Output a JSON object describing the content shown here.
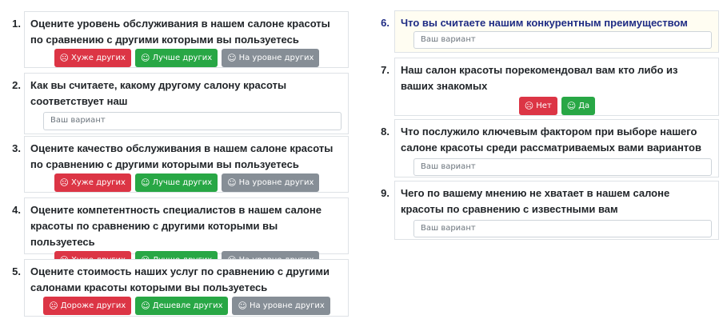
{
  "placeholder": "Ваш вариант",
  "icons": {
    "sad": "sad-face-icon",
    "smile": "smile-face-icon",
    "neutral": "neutral-face-icon"
  },
  "colors": {
    "danger": "#dc3545",
    "success": "#28a745",
    "secondary": "#868e96",
    "active_text": "#1f2c84"
  },
  "questions": {
    "q1": {
      "num": "1.",
      "text": "Оцените уровень обслуживания в нашем салоне красоты по сравнению с другими которыми вы пользуетесь",
      "buttons": [
        "Хуже других",
        "Лучше других",
        "На уровне других"
      ]
    },
    "q2": {
      "num": "2.",
      "text": "Как вы считаете, какому другому салону красоты соответствует наш"
    },
    "q3": {
      "num": "3.",
      "text": "Оцените качество обслуживания в нашем салоне красоты по сравнению с другими которыми вы пользуетесь",
      "buttons": [
        "Хуже других",
        "Лучше других",
        "На уровне других"
      ]
    },
    "q4": {
      "num": "4.",
      "text": "Оцените компетентность специалистов в нашем салоне красоты по сравнению с другими которыми вы пользуетесь",
      "buttons": [
        "Хуже других",
        "Лучше других",
        "На уровне других"
      ]
    },
    "q5": {
      "num": "5.",
      "text": "Оцените стоимость наших услуг по сравнению с другими салонами красоты которыми вы пользуетесь",
      "buttons": [
        "Дороже других",
        "Дешевле других",
        "На уровне других"
      ]
    },
    "q6": {
      "num": "6.",
      "text": "Что вы считаете нашим конкурентным преимуществом"
    },
    "q7": {
      "num": "7.",
      "text": "Наш салон красоты порекомендовал вам кто либо из ваших знакомых",
      "buttons": [
        "Нет",
        "Да"
      ]
    },
    "q8": {
      "num": "8.",
      "text": "Что послужило ключевым фактором при выборе нашего салоне красоты среди рассматриваемых вами вариантов"
    },
    "q9": {
      "num": "9.",
      "text": "Чего по вашему мнению не хватает в нашем салоне красоты по сравнению с известными вам"
    }
  }
}
